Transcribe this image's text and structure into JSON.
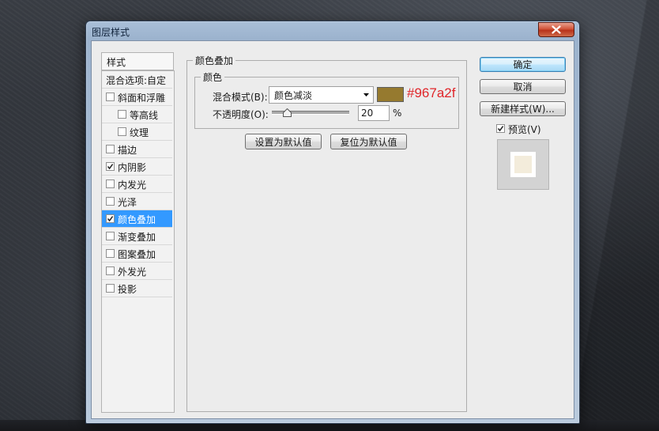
{
  "window": {
    "title": "图层样式"
  },
  "left_panel": {
    "header": "样式",
    "blend_options": "混合选项:自定",
    "items": [
      {
        "label": "斜面和浮雕",
        "checked": false,
        "indent": false,
        "selected": false
      },
      {
        "label": "等高线",
        "checked": false,
        "indent": true,
        "selected": false
      },
      {
        "label": "纹理",
        "checked": false,
        "indent": true,
        "selected": false
      },
      {
        "label": "描边",
        "checked": false,
        "indent": false,
        "selected": false
      },
      {
        "label": "内阴影",
        "checked": true,
        "indent": false,
        "selected": false
      },
      {
        "label": "内发光",
        "checked": false,
        "indent": false,
        "selected": false
      },
      {
        "label": "光泽",
        "checked": false,
        "indent": false,
        "selected": false
      },
      {
        "label": "颜色叠加",
        "checked": true,
        "indent": false,
        "selected": true
      },
      {
        "label": "渐变叠加",
        "checked": false,
        "indent": false,
        "selected": false
      },
      {
        "label": "图案叠加",
        "checked": false,
        "indent": false,
        "selected": false
      },
      {
        "label": "外发光",
        "checked": false,
        "indent": false,
        "selected": false
      },
      {
        "label": "投影",
        "checked": false,
        "indent": false,
        "selected": false
      }
    ]
  },
  "overlay": {
    "group_title": "颜色叠加",
    "subgroup_title": "颜色",
    "blend_mode_label": "混合模式(B):",
    "blend_mode_value": "颜色减淡",
    "color": "#967a2f",
    "color_annotation": "#967a2f",
    "opacity_label": "不透明度(O):",
    "opacity_value": "20",
    "opacity_unit": "%",
    "opacity_fraction": 0.2,
    "set_default_label": "设置为默认值",
    "reset_default_label": "复位为默认值"
  },
  "actions": {
    "ok_label": "确定",
    "cancel_label": "取消",
    "new_style_label": "新建样式(W)...",
    "preview_label": "预览(V)",
    "preview_checked": true,
    "preview_color": "#f3ecdb"
  },
  "colors": {
    "selection": "#3399ff",
    "annotation": "#e0262a"
  }
}
